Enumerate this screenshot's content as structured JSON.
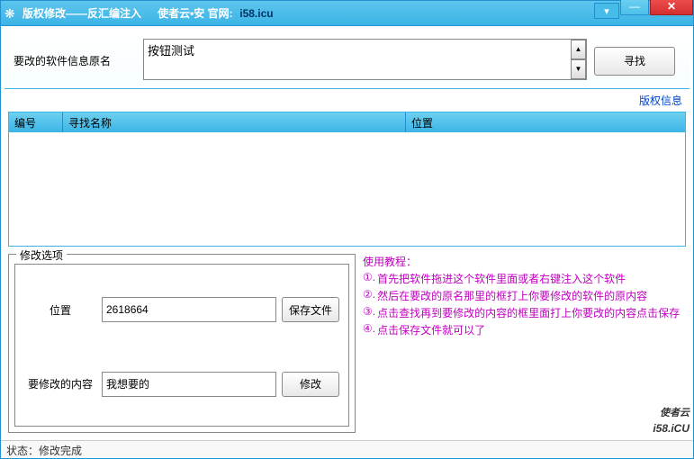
{
  "titlebar": {
    "icon": "❋",
    "title1": "版权修改——反汇编注入",
    "title2": "使者云•安 官网:",
    "url": "i58.icu"
  },
  "search": {
    "label": "要改的软件信息原名",
    "value": "按钮测试",
    "find_btn": "寻找"
  },
  "link_row": {
    "copyright_info": "版权信息"
  },
  "table": {
    "col1": "编号",
    "col2": "寻找名称",
    "col3": "位置"
  },
  "modify": {
    "panel_title": "修改选项",
    "pos_label": "位置",
    "pos_value": "2618664",
    "save_btn": "保存文件",
    "content_label": "要修改的内容",
    "content_value": "我想要的",
    "modify_btn": "修改"
  },
  "tutorial": {
    "title": "使用教程：",
    "items": [
      "首先把软件拖进这个软件里面或者右键注入这个软件",
      "然后在要改的原名那里的框打上你要修改的软件的原内容",
      "点击查找再到要修改的内容的框里面打上你要改的内容点击保存",
      "点击保存文件就可以了"
    ],
    "nums": [
      "①.",
      "②.",
      "③.",
      "④."
    ]
  },
  "watermark": {
    "top": "使者云",
    "main": "i58.iCU"
  },
  "statusbar": {
    "prefix": "状态：",
    "text": "修改完成"
  }
}
